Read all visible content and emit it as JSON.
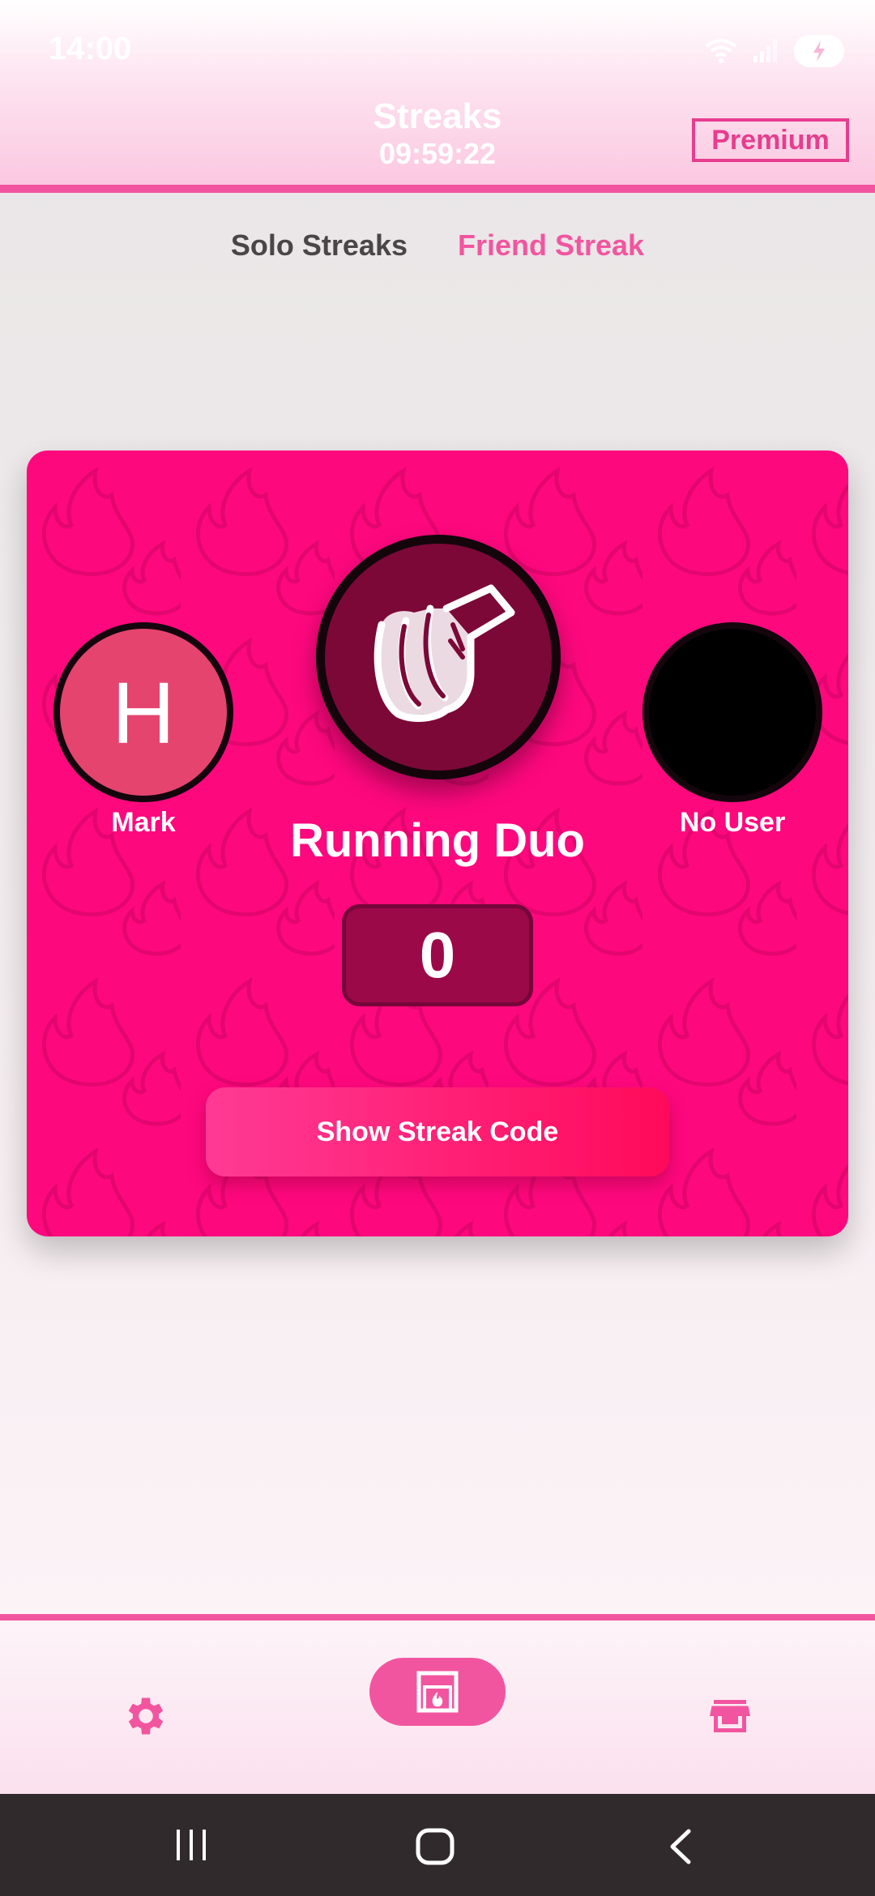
{
  "status_bar": {
    "time": "14:00"
  },
  "header": {
    "title": "Streaks",
    "timer": "09:59:22",
    "premium_label": "Premium"
  },
  "tabs": [
    {
      "label": "Solo Streaks",
      "active": false
    },
    {
      "label": "Friend Streak",
      "active": true
    }
  ],
  "streak_card": {
    "user_initial": "H",
    "user_name": "Mark",
    "partner_name": "No User",
    "streak_name": "Running Duo",
    "streak_count": "0",
    "button_label": "Show Streak Code",
    "emblem_icon": "running-shoe-icon"
  },
  "bottom_nav": {
    "items": [
      {
        "icon": "gear-icon",
        "active": false
      },
      {
        "icon": "fireplace-icon",
        "active": true
      },
      {
        "icon": "store-icon",
        "active": false
      }
    ]
  },
  "colors": {
    "accent": "#f2559f",
    "card_background": "#fe087e",
    "counter_background": "#9c0948",
    "emblem_background": "#7c0838"
  }
}
